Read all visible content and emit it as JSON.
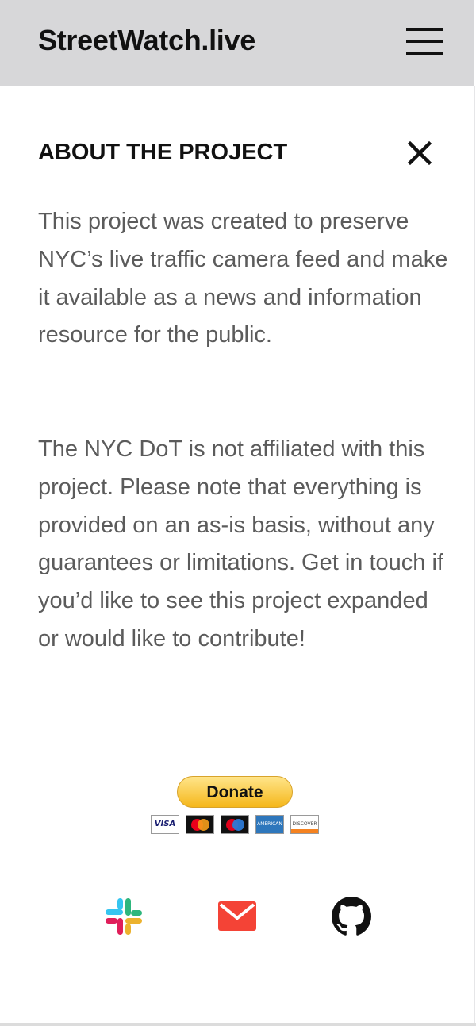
{
  "header": {
    "site_title": "StreetWatch.live",
    "menu_icon": "hamburger-menu-icon"
  },
  "about": {
    "title": "ABOUT THE PROJECT",
    "close_icon": "close-icon",
    "paragraph_1": "This project was created to preserve NYC’s live traffic camera feed and make it available as a news and information resource for the public.",
    "paragraph_2": "The NYC DoT is not affiliated with this project. Please note that everything is provided on an as-is basis, without any guarantees or limitations. Get in touch if you’d like to see this project expanded or would like to contribute!"
  },
  "donate": {
    "label": "Donate",
    "visa_label": "VISA",
    "amex_label": "AMERICAN EXPRESS",
    "discover_label": "DISCOVER",
    "card_icons": [
      "visa-card-icon",
      "mastercard-icon",
      "maestro-card-icon",
      "amex-card-icon",
      "discover-card-icon"
    ]
  },
  "social": {
    "icons": [
      "slack-icon",
      "mail-icon",
      "github-icon"
    ]
  },
  "colors": {
    "header_bg": "#d7d7d9",
    "body_text": "#5b5b5b",
    "donate_yellow": "#f5b71b",
    "mail_red": "#f44336"
  }
}
